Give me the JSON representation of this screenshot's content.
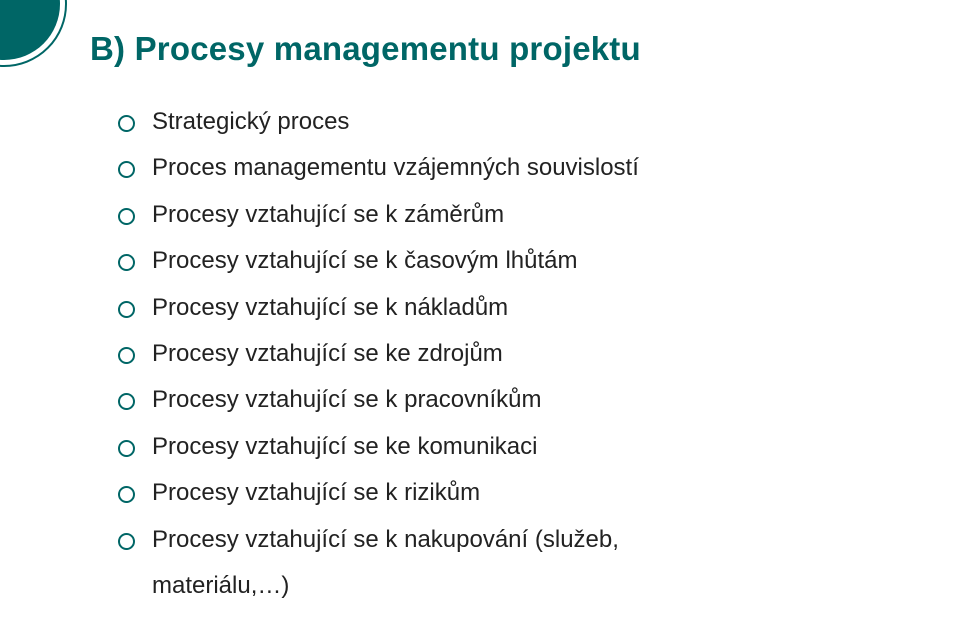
{
  "accent_color": "#006666",
  "title": "B) Procesy managementu projektu",
  "bullets": [
    "Strategický proces",
    "Proces managementu vzájemných souvislostí",
    "Procesy vztahující se k záměrům",
    "Procesy vztahující se k časovým lhůtám",
    "Procesy vztahující se k nákladům",
    "Procesy vztahující se ke zdrojům",
    "Procesy vztahující se k pracovníkům",
    "Procesy vztahující se ke komunikaci",
    "Procesy vztahující se k rizikům",
    "Procesy vztahující se k nakupování (služeb,"
  ],
  "bullet_continuation": "materiálu,…)"
}
